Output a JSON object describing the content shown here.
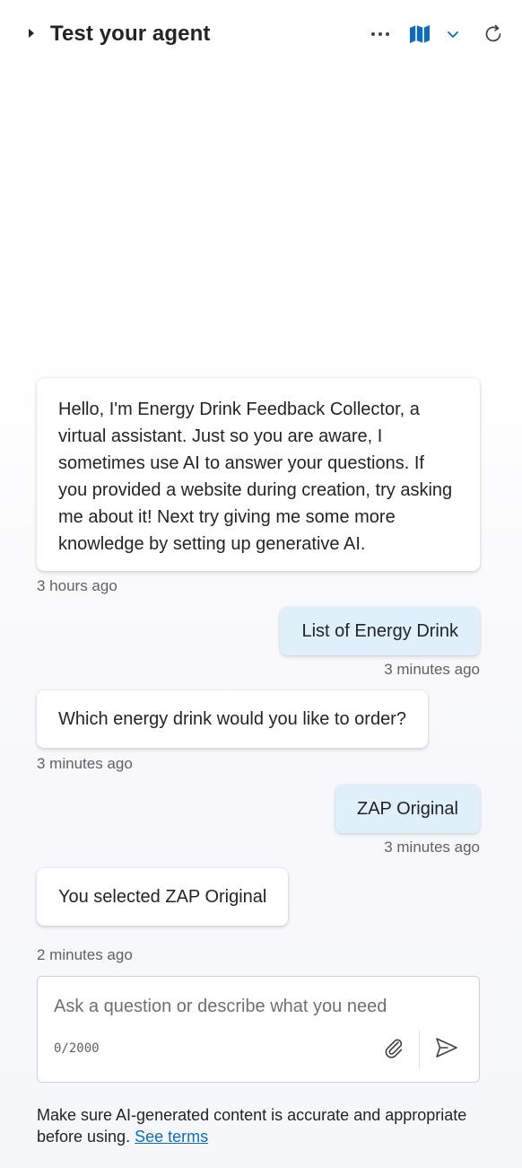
{
  "header": {
    "title": "Test your agent",
    "collapse_icon": "caret-right-icon",
    "more_icon": "more-horizontal-icon",
    "map_icon": "map-icon",
    "dropdown_icon": "chevron-down-icon",
    "refresh_icon": "refresh-icon",
    "accent_color": "#0f6cbd"
  },
  "messages": [
    {
      "role": "bot",
      "text": "Hello, I'm Energy Drink Feedback Collector, a virtual assistant. Just so you are aware, I sometimes use AI to answer your questions. If you provided a website during creation, try asking me about it! Next try giving me some more knowledge by setting up generative AI.",
      "time": "3 hours ago"
    },
    {
      "role": "user",
      "text": "List of Energy Drink",
      "time": "3 minutes ago"
    },
    {
      "role": "bot",
      "text": "Which energy drink would you like to order?",
      "time": "3 minutes ago"
    },
    {
      "role": "user",
      "text": "ZAP Original",
      "time": "3 minutes ago"
    },
    {
      "role": "bot",
      "text": "You selected ZAP Original",
      "time": "2 minutes ago"
    }
  ],
  "composer": {
    "placeholder": "Ask a question or describe what you need",
    "value": "",
    "counter": "0/2000",
    "attach_icon": "paperclip-icon",
    "send_icon": "send-icon"
  },
  "footer": {
    "disclaimer": "Make sure AI-generated content is accurate and appropriate before using.",
    "link": "See terms"
  }
}
